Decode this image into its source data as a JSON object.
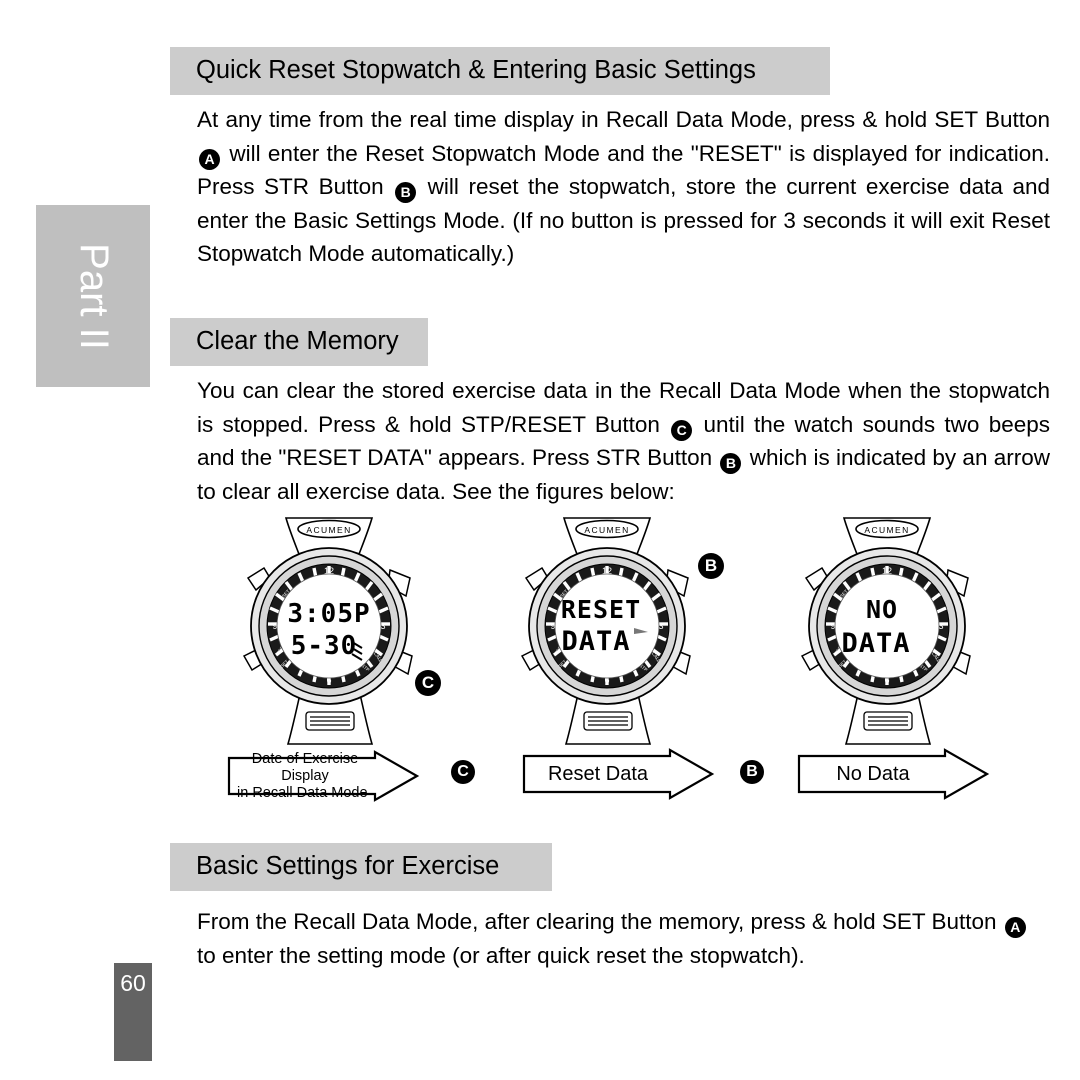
{
  "page": {
    "part_label": "Part II",
    "page_number": "60"
  },
  "sections": [
    {
      "id": "quick-reset",
      "heading": "Quick Reset Stopwatch & Entering Basic Settings"
    },
    {
      "id": "clear-memory",
      "heading": "Clear the Memory"
    },
    {
      "id": "basic-settings",
      "heading": "Basic Settings for Exercise"
    }
  ],
  "paragraphs": {
    "quick_reset": {
      "p1": "At any time from the real time display in Recall Data Mode, press & hold SET Button ",
      "badge1": "A",
      "p2": " will enter the Reset Stopwatch Mode and the \"RESET\" is displayed for indication. Press STR Button ",
      "badge2": "B",
      "p3": " will reset the stopwatch, store the current exercise data and enter the Basic Settings Mode. (If no button is pressed for 3 seconds it will exit Reset Stopwatch Mode automatically.)"
    },
    "clear_memory": {
      "p1": "You can clear the stored exercise data in the Recall Data Mode when the stopwatch is stopped. Press & hold STP/RESET Button ",
      "badge1": "C",
      "p2": " until the watch sounds two beeps and the \"RESET DATA\" appears. Press STR Button ",
      "badge2": "B",
      "p3": " which is indicated by an arrow to clear all exercise data. See the figures below:"
    },
    "basic_settings": {
      "p1": "From the Recall Data Mode, after clearing the memory, press & hold SET Button ",
      "badge1": "A",
      "p2": " to enter the setting mode (or after quick reset the stopwatch)."
    }
  },
  "figures": [
    {
      "id": "watch-1",
      "brand": "ACUMEN",
      "lcd_line1": "3:05P",
      "lcd_line2": "5-30",
      "bezel_markers": [
        "12",
        "3",
        "6",
        "9"
      ],
      "badge": "C",
      "caption_line1": "Date of Exercise Display",
      "caption_line2": "in Recall Data Mode",
      "caption_badge": "C"
    },
    {
      "id": "watch-2",
      "brand": "ACUMEN",
      "lcd_line1": "RESET",
      "lcd_line2": "DATA",
      "bezel_markers": [
        "12",
        "3",
        "6",
        "9"
      ],
      "badge": "B",
      "caption_line1": "Reset Data",
      "caption_line2": "",
      "caption_badge": "B"
    },
    {
      "id": "watch-3",
      "brand": "ACUMEN",
      "lcd_line1": "NO",
      "lcd_line2": "DATA",
      "bezel_markers": [
        "12",
        "3",
        "6",
        "9"
      ],
      "badge": "",
      "caption_line1": "No Data",
      "caption_line2": "",
      "caption_badge": ""
    }
  ],
  "colors": {
    "header_bg": "#cccccc",
    "part_tab_bg": "#bfbfbf",
    "page_number_bg": "#636363",
    "text": "#000000",
    "page_bg": "#ffffff"
  }
}
